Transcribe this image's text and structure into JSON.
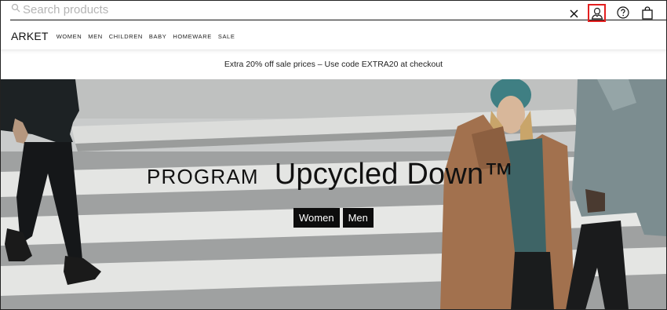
{
  "search": {
    "placeholder": "Search products",
    "value": ""
  },
  "header_icons": {
    "close": "close-icon",
    "account": "account-icon",
    "help": "help-icon",
    "bag": "shopping-bag-icon",
    "account_highlight_color": "#e32020"
  },
  "brand": {
    "logo": "ARKET"
  },
  "nav": {
    "items": [
      {
        "label": "WOMEN"
      },
      {
        "label": "MEN"
      },
      {
        "label": "CHILDREN"
      },
      {
        "label": "BABY"
      },
      {
        "label": "HOMEWARE"
      },
      {
        "label": "SALE"
      }
    ]
  },
  "promo": {
    "text": "Extra 20% off sale prices – Use code EXTRA20 at checkout"
  },
  "hero": {
    "kicker": "PROGRAM",
    "headline": "Upcycled Down™",
    "buttons": [
      {
        "label": "Women"
      },
      {
        "label": "Men"
      }
    ]
  }
}
